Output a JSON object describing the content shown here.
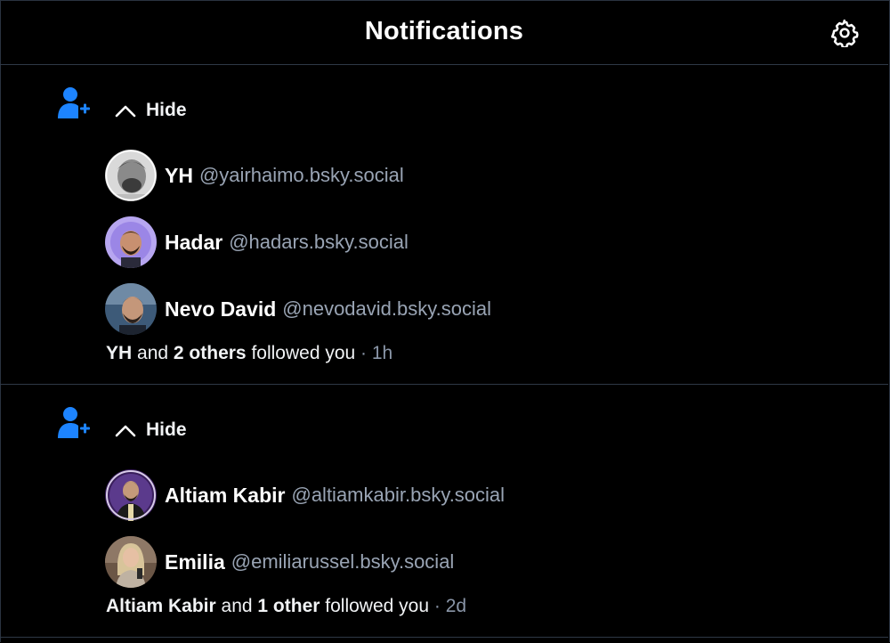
{
  "header": {
    "title": "Notifications",
    "settings_icon": "gear-icon"
  },
  "colors": {
    "background": "#000000",
    "accent": "#1d84ff",
    "handle": "#99a4b4",
    "divider": "#2e3846"
  },
  "groups": [
    {
      "type": "follow",
      "icon": "person-add-icon",
      "hide_label": "Hide",
      "users": [
        {
          "name": "YH",
          "handle": "@yairhaimo.bsky.social"
        },
        {
          "name": "Hadar",
          "handle": "@hadars.bsky.social"
        },
        {
          "name": "Nevo David",
          "handle": "@nevodavid.bsky.social"
        }
      ],
      "summary": {
        "first": "YH",
        "and": " and ",
        "others": "2 others",
        "action": " followed you",
        "sep": " · ",
        "time": "1h"
      }
    },
    {
      "type": "follow",
      "icon": "person-add-icon",
      "hide_label": "Hide",
      "users": [
        {
          "name": "Altiam Kabir",
          "handle": "@altiamkabir.bsky.social"
        },
        {
          "name": "Emilia",
          "handle": "@emiliarussel.bsky.social"
        }
      ],
      "summary": {
        "first": "Altiam Kabir",
        "and": " and ",
        "others": "1 other",
        "action": " followed you",
        "sep": " · ",
        "time": "2d"
      }
    }
  ]
}
